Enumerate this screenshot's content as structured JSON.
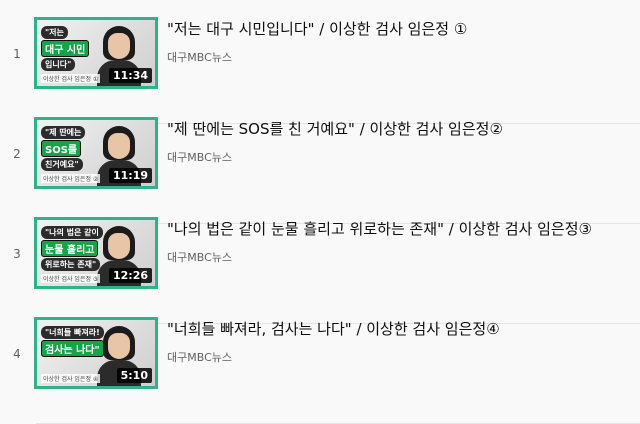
{
  "playlist": {
    "items": [
      {
        "index": "1",
        "title": "\"저는 대구 시민입니다\" / 이상한 검사 임은정 ①",
        "channel": "대구MBC뉴스",
        "duration": "11:34",
        "thumb_line1": "\"저는",
        "thumb_line2": "대구 시민",
        "thumb_line3": "입니다\"",
        "thumb_caption": "이상한 검사 임은정 ①"
      },
      {
        "index": "2",
        "title": "\"제 딴에는 SOS를 친 거예요\" / 이상한 검사 임은정②",
        "channel": "대구MBC뉴스",
        "duration": "11:19",
        "thumb_line1": "\"제 딴에는",
        "thumb_line2": "SOS를",
        "thumb_line3": "친거예요\"",
        "thumb_caption": "이상한 검사 임은정 ②"
      },
      {
        "index": "3",
        "title": "\"나의 법은 같이 눈물 흘리고 위로하는 존재\" / 이상한 검사 임은정③",
        "channel": "대구MBC뉴스",
        "duration": "12:26",
        "thumb_line1": "\"나의 법은 같이",
        "thumb_line2": "눈물 흘리고",
        "thumb_line3": "위로하는 존재\"",
        "thumb_caption": "이상한 검사 임은정 ③"
      },
      {
        "index": "4",
        "title": "\"너희들 빠져라, 검사는 나다\" / 이상한 검사 임은정④",
        "channel": "대구MBC뉴스",
        "duration": "5:10",
        "thumb_line1": "\"너희들 빠져라!",
        "thumb_line2": "검사는 나다\"",
        "thumb_line3": "",
        "thumb_caption": "이상한 검사 임은정 ④"
      }
    ]
  },
  "colors": {
    "thumb_border": "#2db38a",
    "thumb_accent": "#16a34a",
    "text_primary": "#0f0f0f",
    "text_secondary": "#606060",
    "background": "#f9f9f9"
  }
}
